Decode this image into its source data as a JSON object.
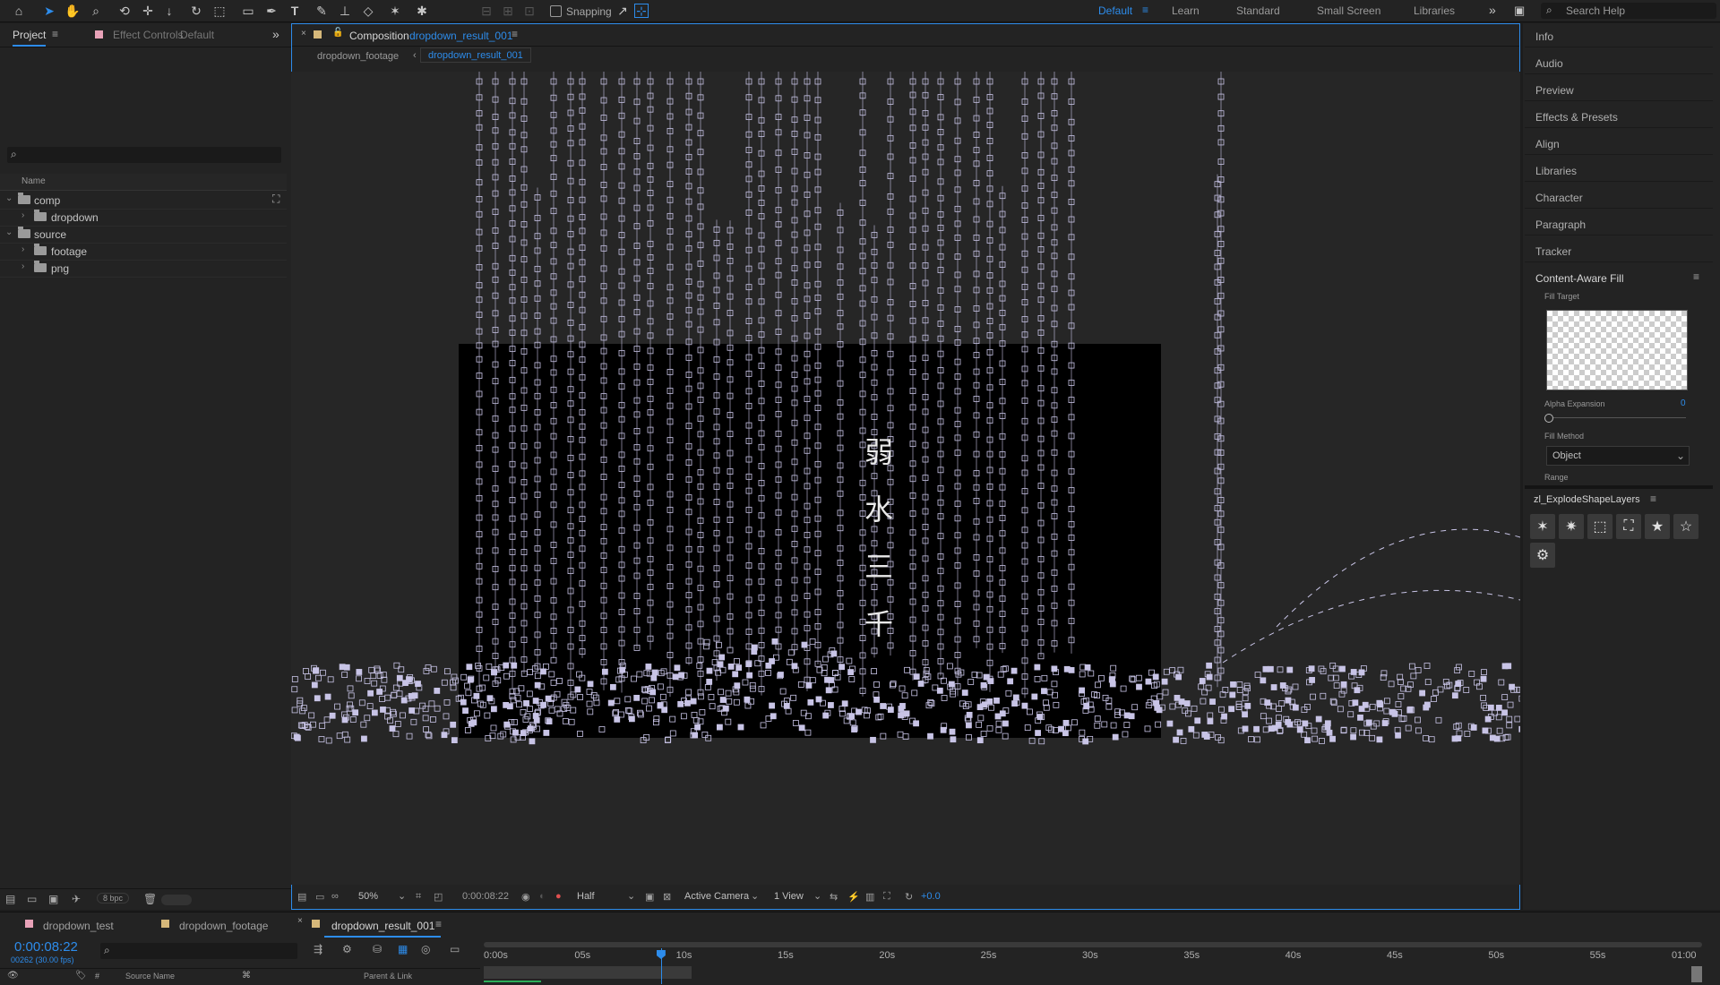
{
  "toolbar": {
    "snapping_label": "Snapping",
    "workspaces": [
      "Default",
      "Learn",
      "Standard",
      "Small Screen",
      "Libraries"
    ],
    "active_workspace": "Default",
    "search_placeholder": "Search Help"
  },
  "project_panel": {
    "tab_project": "Project",
    "tab_effect_controls": "Effect Controls",
    "effect_controls_target": "Default",
    "column_name": "Name",
    "tree": [
      {
        "label": "comp",
        "level": 0,
        "expanded": true
      },
      {
        "label": "dropdown",
        "level": 1,
        "expanded": false
      },
      {
        "label": "source",
        "level": 0,
        "expanded": true
      },
      {
        "label": "footage",
        "level": 1,
        "expanded": false
      },
      {
        "label": "png",
        "level": 1,
        "expanded": false
      }
    ],
    "bpc_label": "8 bpc"
  },
  "composition": {
    "tab_prefix": "Composition",
    "tab_name": "dropdown_result_001",
    "breadcrumbs": [
      "dropdown_footage",
      "dropdown_result_001"
    ],
    "title_chars": [
      "弱",
      "水",
      "三",
      "千"
    ],
    "footer": {
      "zoom": "50%",
      "timecode": "0:00:08:22",
      "resolution": "Half",
      "camera": "Active Camera",
      "views": "1 View",
      "exposure": "+0.0"
    }
  },
  "right_panel": {
    "items": [
      "Info",
      "Audio",
      "Preview",
      "Effects & Presets",
      "Align",
      "Libraries",
      "Character",
      "Paragraph",
      "Tracker"
    ],
    "caf_title": "Content-Aware Fill",
    "fill_target_label": "Fill Target",
    "alpha_expansion_label": "Alpha Expansion",
    "alpha_expansion_value": "0",
    "fill_method_label": "Fill Method",
    "fill_method_value": "Object",
    "range_label": "Range",
    "plugin_title": "zl_ExplodeShapeLayers"
  },
  "timeline": {
    "tabs": [
      "dropdown_test",
      "dropdown_footage",
      "dropdown_result_001"
    ],
    "active_tab": "dropdown_result_001",
    "current_time": "0:00:08:22",
    "frame_info": "00262 (30.00 fps)",
    "source_name_label": "Source Name",
    "parent_link_label": "Parent & Link",
    "ruler": [
      "0:00s",
      "05s",
      "10s",
      "15s",
      "20s",
      "25s",
      "30s",
      "35s",
      "40s",
      "45s",
      "50s",
      "55s",
      "01:00"
    ],
    "playhead_seconds": 8.73,
    "duration_seconds": 60
  },
  "colors": {
    "accent": "#2d8ceb",
    "shape_outline": "#c8c4e6",
    "comp_background": "#000000"
  }
}
